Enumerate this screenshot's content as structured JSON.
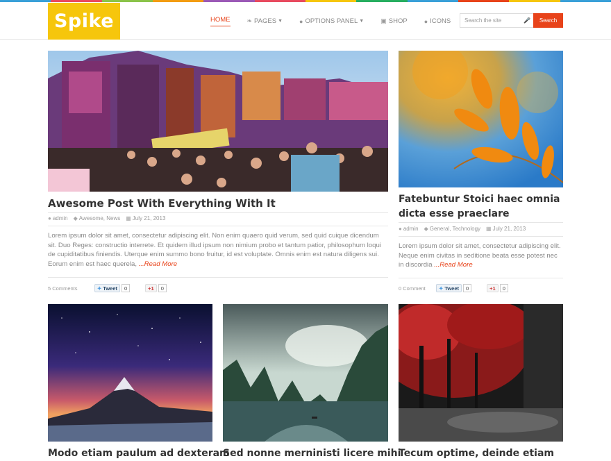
{
  "colors": {
    "accent": "#e8431a",
    "logo_bg": "#f6c60c",
    "stripe": [
      "#3aa0d8",
      "#e84a5f",
      "#8bc34a",
      "#f39c12",
      "#9b59b6",
      "#e84a5f",
      "#f6c60c",
      "#27ae60",
      "#3aa0d8",
      "#e8431a",
      "#f6c60c",
      "#3aa0d8"
    ]
  },
  "header": {
    "logo": "Spike",
    "nav": [
      {
        "label": "HOME",
        "icon": "",
        "active": true
      },
      {
        "label": "PAGES",
        "icon": "leaf-icon",
        "dropdown": true
      },
      {
        "label": "OPTIONS PANEL",
        "icon": "user-icon",
        "dropdown": true
      },
      {
        "label": "SHOP",
        "icon": "cart-icon"
      },
      {
        "label": "ICONS",
        "icon": "apple-icon"
      }
    ],
    "search_placeholder": "Search the site",
    "search_button": "Search"
  },
  "posts": [
    {
      "title": "Awesome Post With Everything With It",
      "author": "admin",
      "tags": "Awesome, News",
      "date": "July 21, 2013",
      "excerpt": "Lorem ipsum dolor sit amet, consectetur adipiscing elit. Non enim quaero quid verum, sed quid cuique dicendum sit. Duo Reges: constructio interrete. Et quidem illud ipsum non nimium probo et tantum patior, philosophum loqui de cupiditatibus finiendis. Uterque enim summo bono fruitur, id est voluptate. Omnis enim est natura diligens sui. Eorum enim est haec querela,",
      "read_more": "...Read More",
      "comments": "5 Comments",
      "tweet_label": "Tweet",
      "tweet_count": "0",
      "plus_label": "+1",
      "plus_count": "0"
    },
    {
      "title": "Fatebuntur Stoici haec omnia dicta esse praeclare",
      "author": "admin",
      "tags": "General, Technology",
      "date": "July 21, 2013",
      "excerpt": "Lorem ipsum dolor sit amet, consectetur adipiscing elit. Neque enim civitas in seditione beata esse potest nec in discordia",
      "read_more": "...Read More",
      "comments": "0 Comment",
      "tweet_label": "Tweet",
      "tweet_count": "0",
      "plus_label": "+1",
      "plus_count": "0"
    },
    {
      "title": "Modo etiam paulum ad dexteram"
    },
    {
      "title": "Sed nonne merninisti licere mihi"
    },
    {
      "title": "Tecum optime, deinde etiam"
    }
  ]
}
